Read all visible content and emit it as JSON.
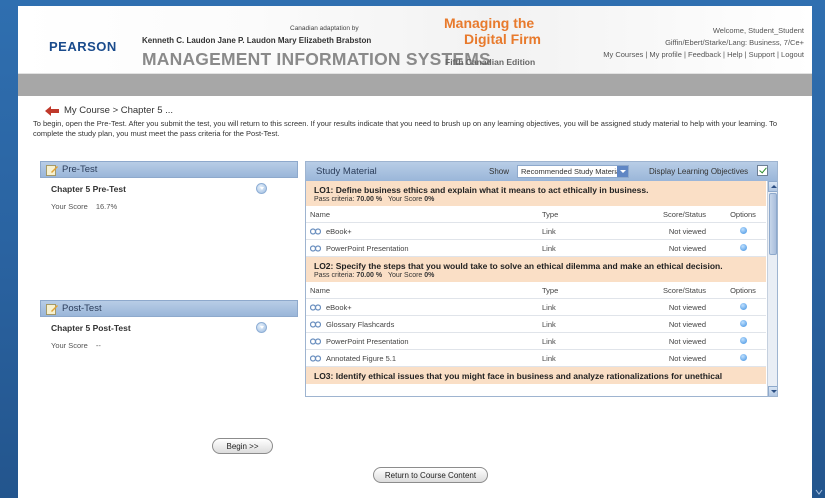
{
  "header": {
    "logo": "PEARSON",
    "adaptation": "Canadian adaptation by",
    "authors": "Kenneth C. Laudon   Jane P. Laudon   Mary Elizabeth Brabston",
    "book_title": "MANAGEMENT INFORMATION SYSTEMS",
    "subtitle_line1": "Managing the",
    "subtitle_line2": "Digital Firm",
    "edition": "Fifth Canadian Edition",
    "welcome": "Welcome, Student_Student",
    "course": "Giffin/Ebert/Starke/Lang: Business, 7/Ce+",
    "links": {
      "my_courses": "My Courses",
      "my_profile": "My profile",
      "feedback": "Feedback",
      "help": "Help",
      "support": "Support",
      "logout": "Logout",
      "sep": " | "
    }
  },
  "breadcrumb": "My Course > Chapter 5 ...",
  "intro": "To begin, open the Pre-Test. After you submit the test, you will return to this screen. If your results indicate that you need to brush up on any learning objectives, you will be assigned study material to help with your learning. To complete the study plan, you must meet the pass criteria for the Post-Test.",
  "pretest": {
    "header": "Pre-Test",
    "name": "Chapter 5 Pre-Test",
    "score_label": "Your Score",
    "score_value": "16.7%"
  },
  "posttest": {
    "header": "Post-Test",
    "name": "Chapter 5 Post-Test",
    "score_label": "Your Score",
    "score_value": "--"
  },
  "study": {
    "header": "Study Material",
    "show_label": "Show",
    "show_value": "Recommended Study Material",
    "display_lo_label": "Display Learning Objectives",
    "display_lo_checked": true,
    "columns": {
      "name": "Name",
      "type": "Type",
      "score": "Score/Status",
      "options": "Options"
    },
    "objectives": [
      {
        "title": "LO1: Define business ethics and explain what it means to act ethically in business.",
        "criteria_label": "Pass criteria:",
        "criteria_value": "70.00 %",
        "score_label": "Your Score",
        "score_value": "0%",
        "items": [
          {
            "name": "eBook+",
            "type": "Link",
            "status": "Not viewed"
          },
          {
            "name": "PowerPoint Presentation",
            "type": "Link",
            "status": "Not viewed"
          }
        ]
      },
      {
        "title": "LO2: Specify the steps that you would take to solve an ethical dilemma and make an ethical decision.",
        "criteria_label": "Pass criteria:",
        "criteria_value": "70.00 %",
        "score_label": "Your Score",
        "score_value": "0%",
        "items": [
          {
            "name": "eBook+",
            "type": "Link",
            "status": "Not viewed"
          },
          {
            "name": "Glossary Flashcards",
            "type": "Link",
            "status": "Not viewed"
          },
          {
            "name": "PowerPoint Presentation",
            "type": "Link",
            "status": "Not viewed"
          },
          {
            "name": "Annotated Figure 5.1",
            "type": "Link",
            "status": "Not viewed"
          }
        ]
      },
      {
        "title": "LO3: Identify ethical issues that you might face in business and analyze rationalizations for unethical",
        "items": []
      }
    ]
  },
  "buttons": {
    "begin": "Begin  >>",
    "return": "Return to Course Content"
  },
  "colors": {
    "background": "#2a63a1",
    "orange": "#e87a2c",
    "panel_head": "#9ab6d9",
    "lo_row": "#fadfc6"
  }
}
